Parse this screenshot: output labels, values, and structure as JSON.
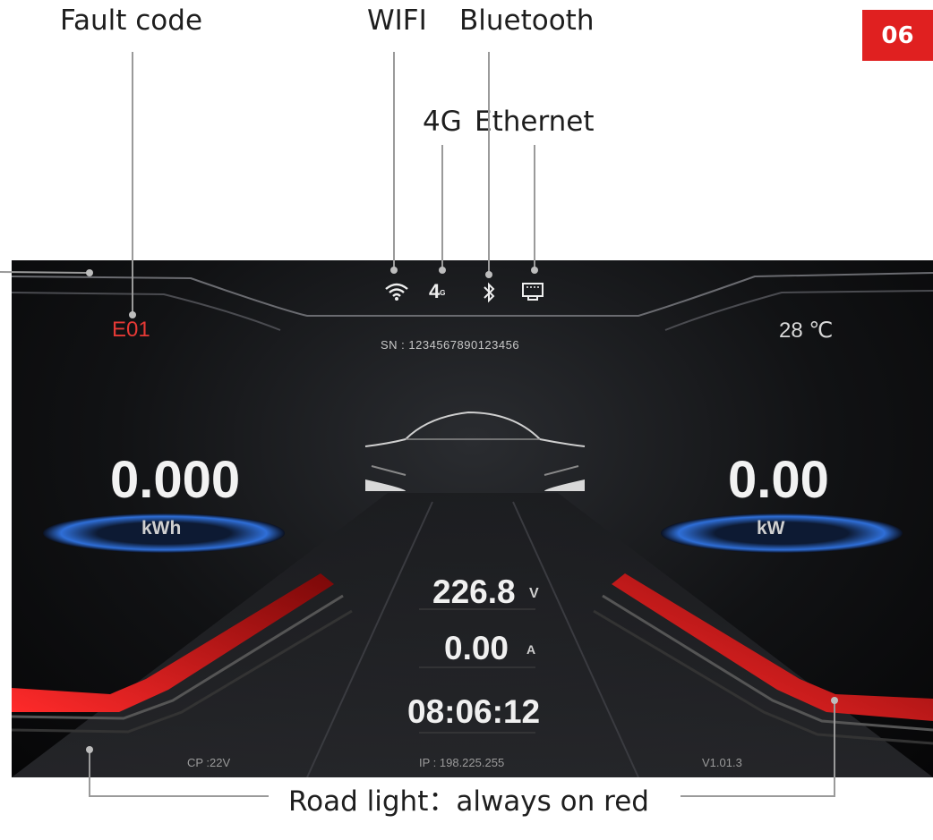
{
  "page_badge": "06",
  "callouts": {
    "fault_code": "Fault code",
    "wifi": "WIFI",
    "bluetooth": "Bluetooth",
    "fourg": "4G",
    "ethernet": "Ethernet",
    "road_light": "Road light：always on red"
  },
  "display": {
    "fault_code_value": "E01",
    "temperature": "28 ℃",
    "serial": "SN : 1234567890123456",
    "energy_value": "0.000",
    "energy_unit": "kWh",
    "power_value": "0.00",
    "power_unit": "kW",
    "voltage_value": "226.8",
    "voltage_unit": "V",
    "current_value": "0.00",
    "current_unit": "A",
    "time": "08:06:12",
    "cp": "CP :22V",
    "ip": "IP : 198.225.255",
    "version": "V1.01.3"
  },
  "icons": {
    "wifi": "wifi-icon",
    "fourg": "4g-signal-icon",
    "bluetooth": "bluetooth-icon",
    "ethernet": "ethernet-icon",
    "car": "car-icon"
  },
  "colors": {
    "accent_red": "#e02020",
    "fault_red": "#e53935",
    "ring_blue": "#3a7bd5"
  }
}
